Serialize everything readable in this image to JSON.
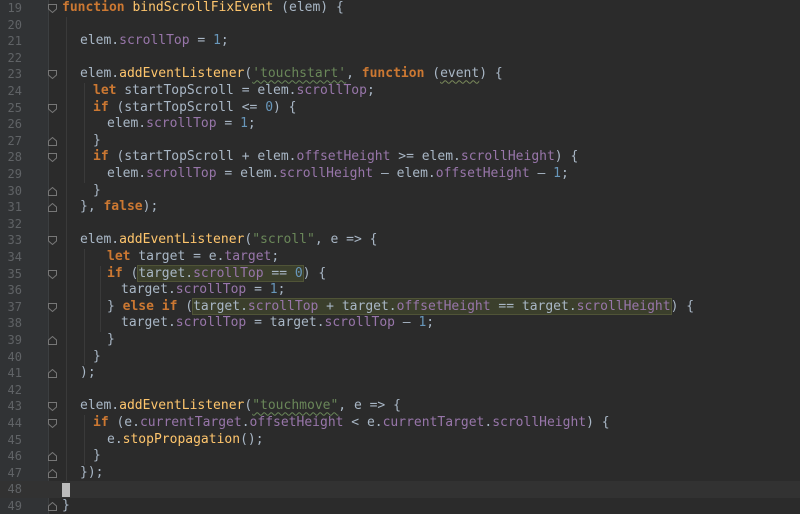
{
  "editor": {
    "line_numbers": [
      "19",
      "20",
      "21",
      "22",
      "23",
      "24",
      "25",
      "26",
      "27",
      "28",
      "29",
      "30",
      "31",
      "32",
      "33",
      "34",
      "35",
      "36",
      "37",
      "38",
      "39",
      "40",
      "41",
      "42",
      "43",
      "44",
      "45",
      "46",
      "47",
      "48",
      "49"
    ],
    "lines": {
      "l19": {
        "kw": "function",
        "fn": "bindScrollFixEvent",
        "rest": " (elem) {"
      },
      "l21": {
        "a": "elem.",
        "prop": "scrollTop",
        "b": " = ",
        "num": "1",
        "c": ";"
      },
      "l23": {
        "a": "elem.",
        "fn": "addEventListener",
        "b": "(",
        "str": "'touchstart'",
        "c": ", ",
        "kw": "function",
        "d": " (",
        "param": "event",
        "e": ") {"
      },
      "l24": {
        "kw": "let",
        "a": " startTopScroll = elem.",
        "prop": "scrollTop",
        "b": ";"
      },
      "l25": {
        "kw": "if",
        "a": " (startTopScroll <= ",
        "num": "0",
        "b": ") {"
      },
      "l26": {
        "a": "elem.",
        "prop": "scrollTop",
        "b": " = ",
        "num": "1",
        "c": ";"
      },
      "l27": {
        "a": "}"
      },
      "l28": {
        "kw": "if",
        "a": " (startTopScroll + elem.",
        "prop1": "offsetHeight",
        "b": " >= elem.",
        "prop2": "scrollHeight",
        "c": ") {"
      },
      "l29": {
        "a": "elem.",
        "prop1": "scrollTop",
        "b": " = elem.",
        "prop2": "scrollHeight",
        "c": " – elem.",
        "prop3": "offsetHeight",
        "d": " – ",
        "num": "1",
        "e": ";"
      },
      "l30": {
        "a": "}"
      },
      "l31": {
        "a": "}, ",
        "kw": "false",
        "b": ");"
      },
      "l33": {
        "a": "elem.",
        "fn": "addEventListener",
        "b": "(",
        "str": "\"scroll\"",
        "c": ", e => {"
      },
      "l34": {
        "kw": "let",
        "a": " target = e.",
        "prop": "target",
        "b": ";"
      },
      "l35": {
        "kw": "if",
        "a": " (",
        "h1": "target.",
        "hprop": "scrollTop",
        "h2": " == ",
        "hnum": "0",
        "b": ") {"
      },
      "l36": {
        "a": "target.",
        "prop": "scrollTop",
        "b": " = ",
        "num": "1",
        "c": ";"
      },
      "l37": {
        "a": "} ",
        "kw": "else if",
        "b": " (",
        "h1": "target.",
        "hprop1": "scrollTop",
        "h2": " + target.",
        "hprop2": "offsetHeight",
        "h3": " == target.",
        "hprop3": "scrollHeight",
        "c": ") {"
      },
      "l38": {
        "a": "target.",
        "prop1": "scrollTop",
        "b": " = target.",
        "prop2": "scrollTop",
        "c": " – ",
        "num": "1",
        "d": ";"
      },
      "l39": {
        "a": "}"
      },
      "l40": {
        "a": "}"
      },
      "l41": {
        "a": ");"
      },
      "l43": {
        "a": "elem.",
        "fn": "addEventListener",
        "b": "(",
        "str": "\"touchmove\"",
        "c": ", e => {"
      },
      "l44": {
        "kw": "if",
        "a": " (e.",
        "prop1": "currentTarget",
        "b": ".",
        "prop2": "offsetHeight",
        "c": " < e.",
        "prop3": "currentTarget",
        "d": ".",
        "prop4": "scrollHeight",
        "e": ") {"
      },
      "l45": {
        "a": "e.",
        "fn": "stopPropagation",
        "b": "();"
      },
      "l46": {
        "a": "}"
      },
      "l47": {
        "a": "});"
      },
      "l49": {
        "a": "}"
      }
    }
  }
}
